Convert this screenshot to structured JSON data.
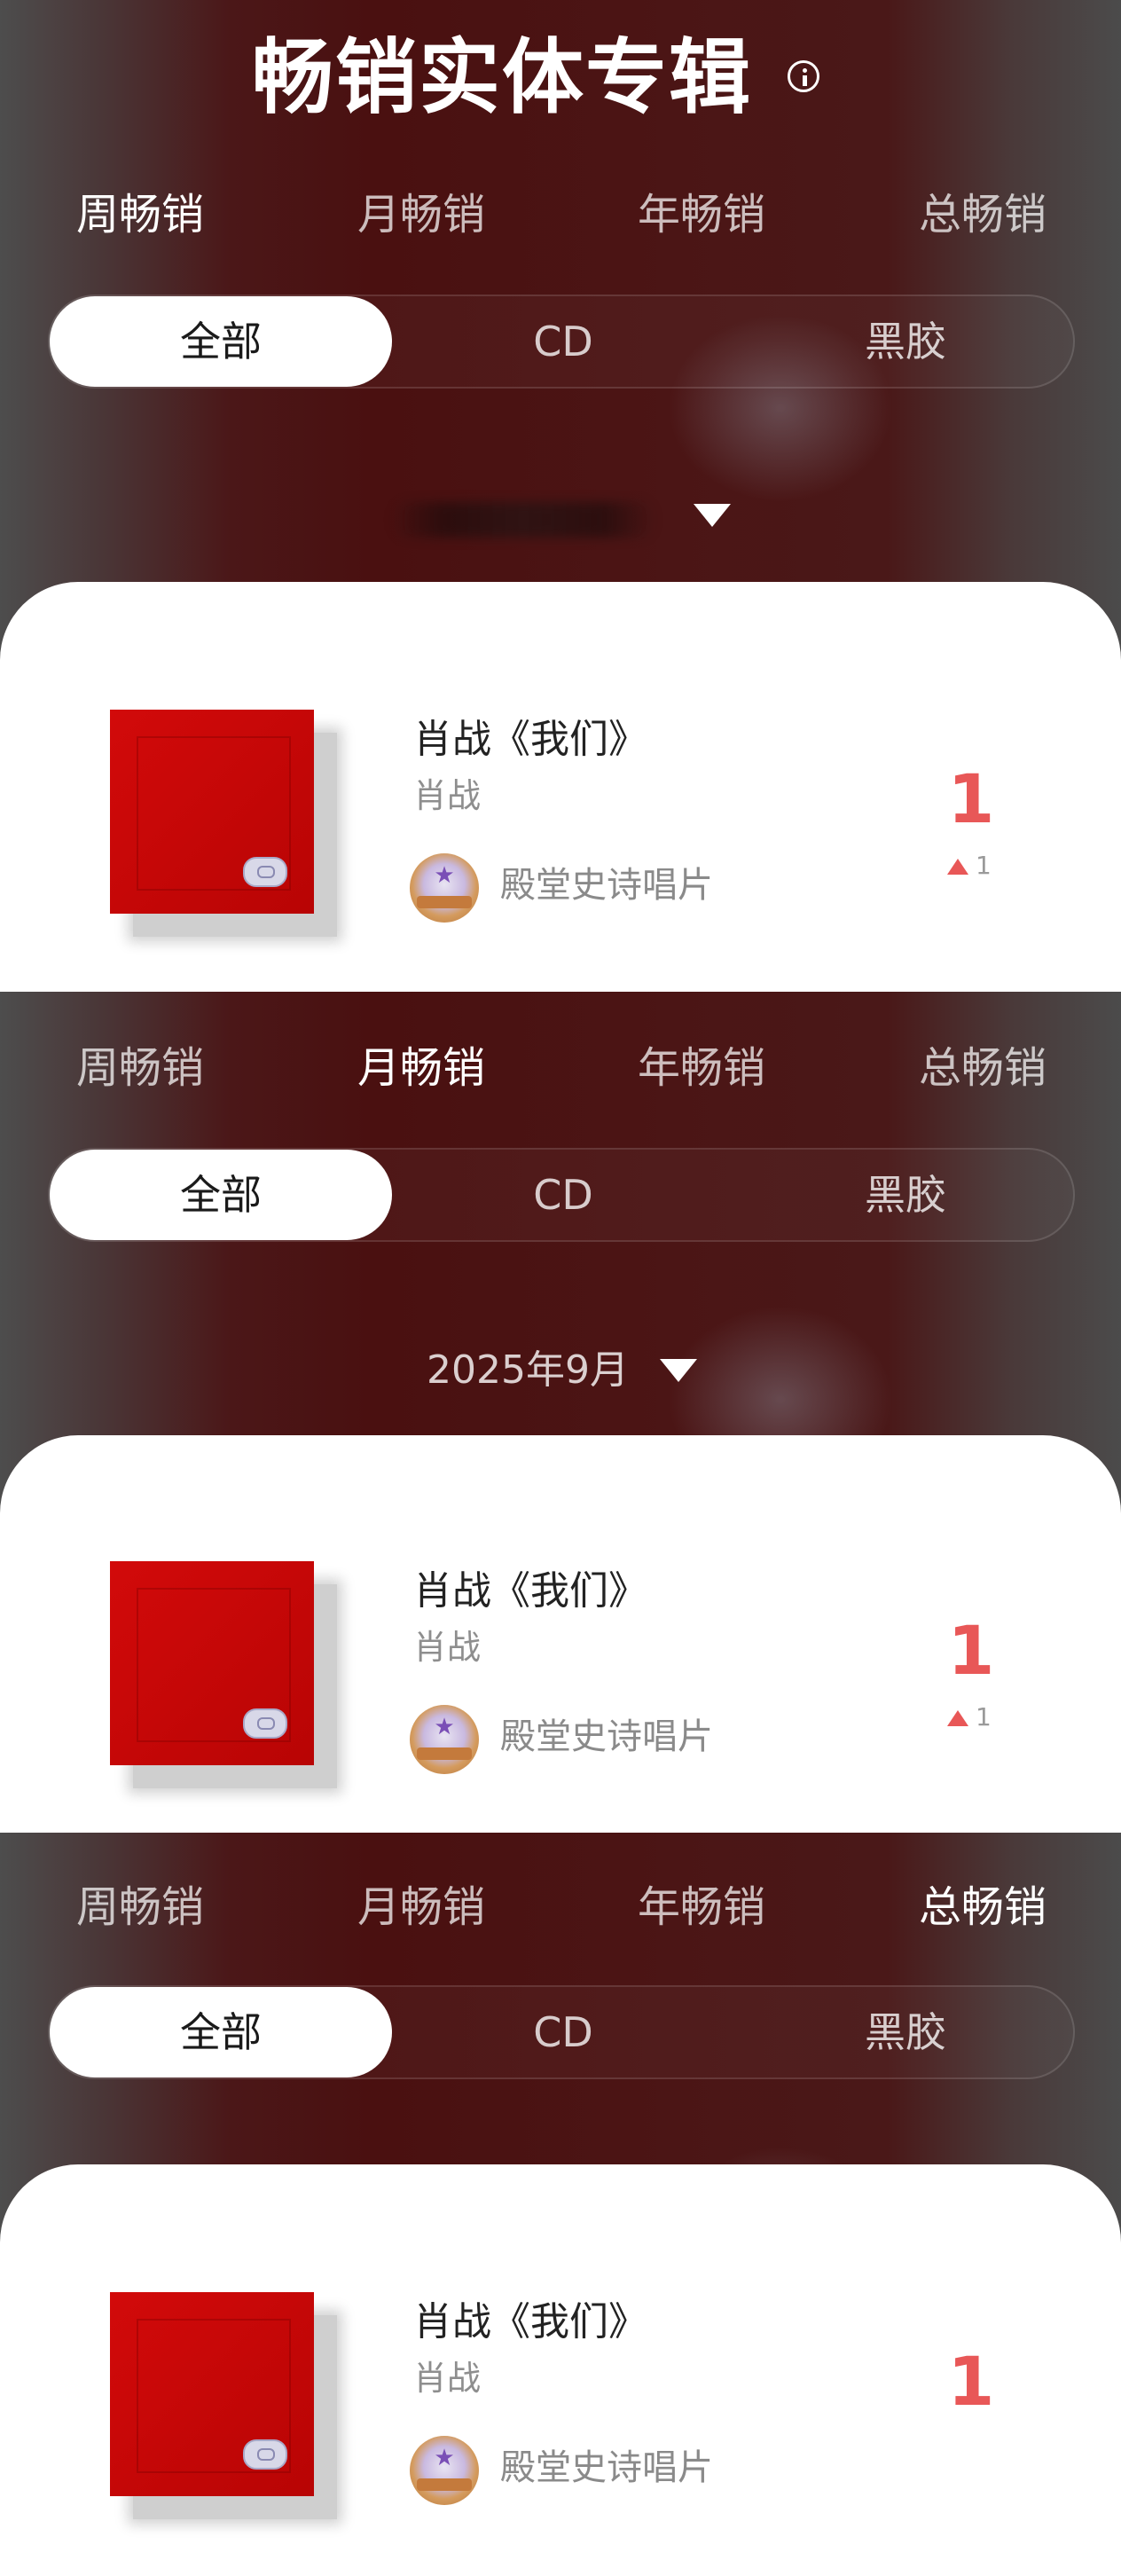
{
  "header": {
    "title": "畅销实体专辑"
  },
  "sections": [
    {
      "tabs": [
        "周畅销",
        "月畅销",
        "年畅销",
        "总畅销"
      ],
      "active_tab": "周畅销",
      "segments": [
        "全部",
        "CD",
        "黑胶"
      ],
      "active_segment": "全部",
      "period": "",
      "entry": {
        "title": "肖战《我们》",
        "artist": "肖战",
        "medal": "殿堂史诗唱片",
        "rank": "1",
        "change": "1"
      }
    },
    {
      "tabs": [
        "周畅销",
        "月畅销",
        "年畅销",
        "总畅销"
      ],
      "active_tab": "月畅销",
      "segments": [
        "全部",
        "CD",
        "黑胶"
      ],
      "active_segment": "全部",
      "period": "2025年9月",
      "entry": {
        "title": "肖战《我们》",
        "artist": "肖战",
        "medal": "殿堂史诗唱片",
        "rank": "1",
        "change": "1"
      }
    },
    {
      "tabs": [
        "周畅销",
        "月畅销",
        "年畅销",
        "总畅销"
      ],
      "active_tab": "总畅销",
      "segments": [
        "全部",
        "CD",
        "黑胶"
      ],
      "active_segment": "全部",
      "entry": {
        "title": "肖战《我们》",
        "artist": "肖战",
        "medal": "殿堂史诗唱片",
        "rank": "1"
      }
    }
  ],
  "colors": {
    "rank_red": "#e85757",
    "background_dark_red": "#4a1010"
  },
  "icons": [
    "info-icon",
    "caret-down-icon",
    "rank-up-icon",
    "medal-icon"
  ]
}
